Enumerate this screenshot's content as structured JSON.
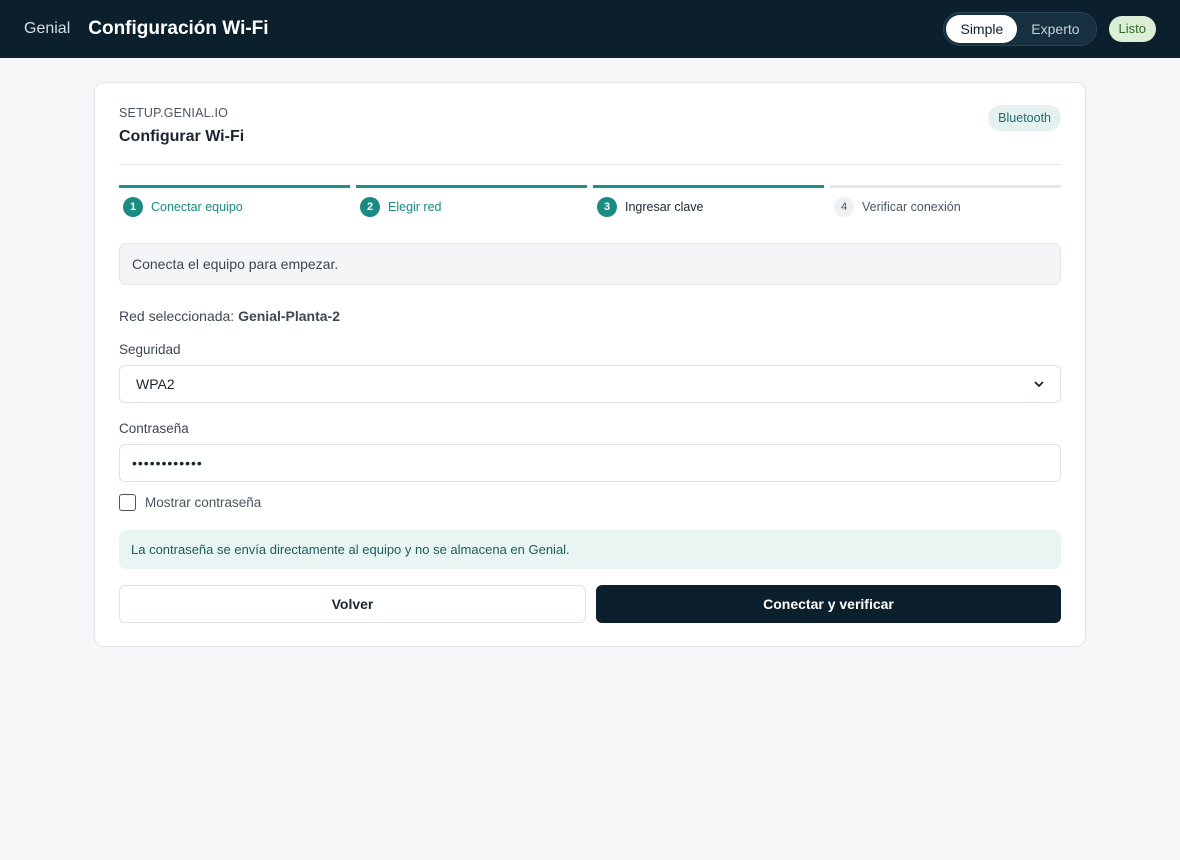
{
  "header": {
    "brand": "Genial",
    "title": "Configuración Wi-Fi",
    "modes": [
      "Simple",
      "Experto"
    ],
    "active_mode": "Simple",
    "status": "Listo"
  },
  "card": {
    "eyebrow": "SETUP.GENIAL.IO",
    "title": "Configurar Wi-Fi",
    "connection_badge": "Bluetooth"
  },
  "steps": [
    {
      "num": "1",
      "label": "Conectar equipo",
      "state": "done"
    },
    {
      "num": "2",
      "label": "Elegir red",
      "state": "done"
    },
    {
      "num": "3",
      "label": "Ingresar clave",
      "state": "current"
    },
    {
      "num": "4",
      "label": "Verificar conexión",
      "state": "pending"
    }
  ],
  "notice": "Conecta el equipo para empezar.",
  "selected_network": {
    "label": "Red seleccionada:",
    "value": "Genial-Planta-2"
  },
  "security": {
    "label": "Seguridad",
    "value": "WPA2"
  },
  "password": {
    "label": "Contraseña",
    "masked_value": "••••••••••••"
  },
  "show_password": {
    "label": "Mostrar contraseña",
    "checked": false
  },
  "info": "La contraseña se envía directamente al equipo y no se almacena en Genial.",
  "actions": {
    "back": "Volver",
    "submit": "Conectar y verificar"
  },
  "colors": {
    "topbar": "#0b1f2c",
    "accent": "#1b8a83",
    "primary_button": "#0b1f2c"
  }
}
